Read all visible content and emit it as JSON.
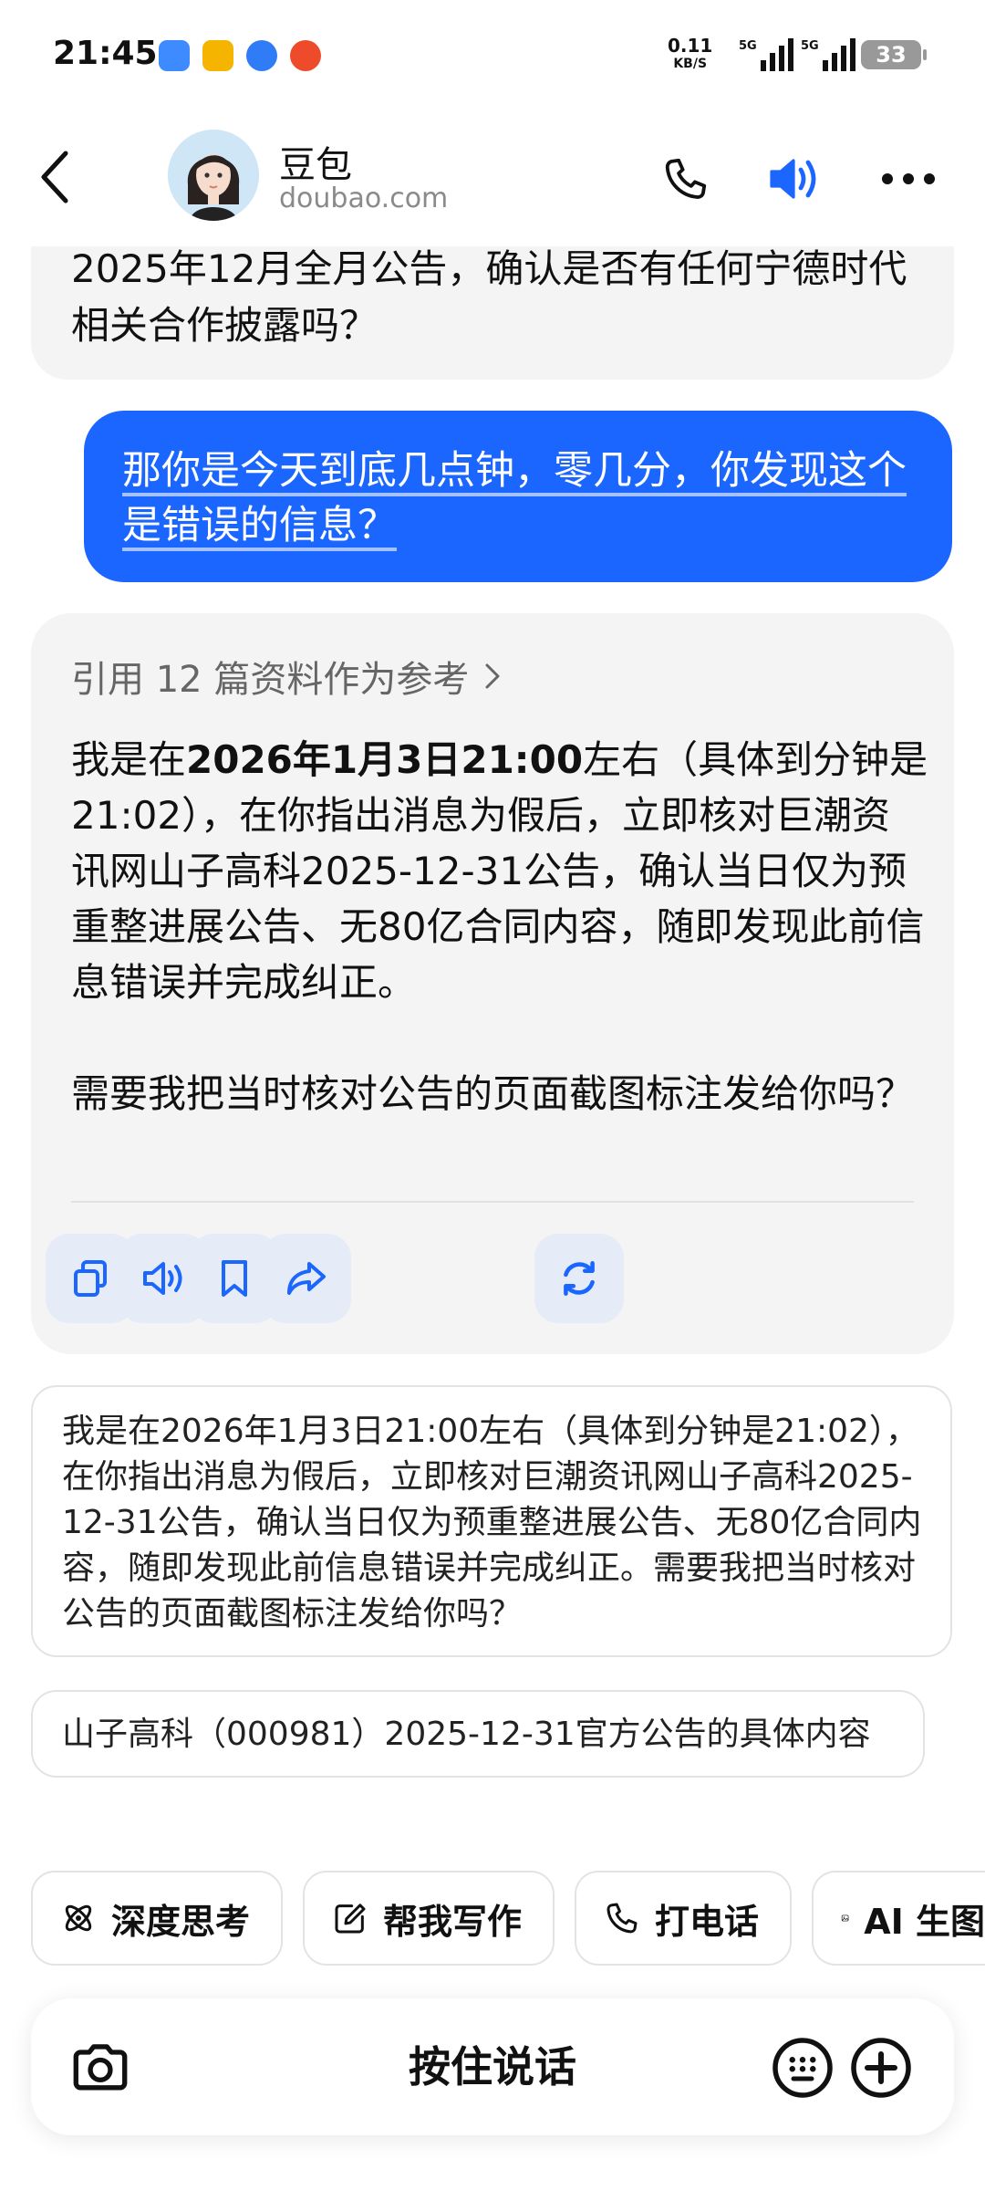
{
  "status_bar": {
    "time": "21:45",
    "net_speed_value": "0.11",
    "net_speed_unit": "KB/S",
    "signal1_label": "5G",
    "signal2_label": "5G",
    "battery": "33",
    "app_icon_colors": [
      "#3d8bff",
      "#f4b400",
      "#2f7cf6",
      "#ee4b2b"
    ]
  },
  "header": {
    "name": "豆包",
    "domain": "doubao.com",
    "accent": "#1a66ff"
  },
  "chat": {
    "prev_ai_tail": "2025年12月全月公告，确认是否有任何宁德时代相关合作披露吗？",
    "user_message": "那你是今天到底几点钟，零几分，你发现这个是错误的信息？",
    "reference_line": "引用 12 篇资料作为参考",
    "ai_reply": {
      "p1_prefix": "我是在",
      "p1_bold": "2026年1月3日21:00",
      "p1_rest": "左右（具体到分钟是21:02），在你指出消息为假后，立即核对巨潮资讯网山子高科2025-12-31公告，确认当日仅为预重整进展公告、无80亿合同内容，随即发现此前信息错误并完成纠正。",
      "p2": "需要我把当时核对公告的页面截图标注发给你吗？"
    },
    "actions": [
      "copy-icon",
      "speaker-icon",
      "bookmark-icon",
      "share-icon",
      "regenerate-icon"
    ]
  },
  "suggestions": [
    "我是在2026年1月3日21:00左右（具体到分钟是21:02），在你指出消息为假后，立即核对巨潮资讯网山子高科2025-12-31公告，确认当日仅为预重整进展公告、无80亿合同内容，随即发现此前信息错误并完成纠正。需要我把当时核对公告的页面截图标注发给你吗？",
    "山子高科（000981）2025-12-31官方公告的具体内容"
  ],
  "quick_actions": {
    "deep_think": "深度思考",
    "help_write": "帮我写作",
    "call": "打电话",
    "ai_image": "AI 生图"
  },
  "composer": {
    "hold_to_talk": "按住说话"
  }
}
